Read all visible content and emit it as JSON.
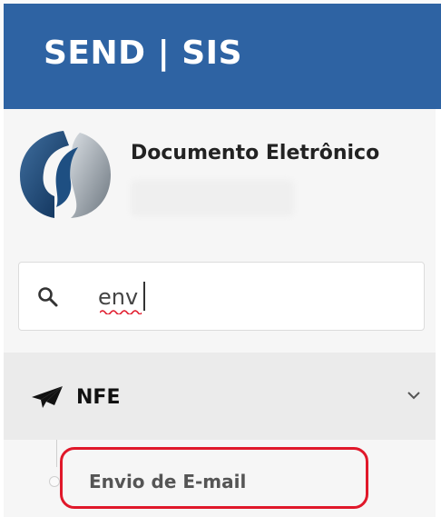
{
  "header": {
    "title": "SEND | SIS",
    "background": "#2e63a3"
  },
  "sidebar": {
    "profile": {
      "title": "Documento Eletrônico"
    },
    "search": {
      "value": "env",
      "icon": "search-icon"
    },
    "menu": [
      {
        "label": "NFE",
        "icon": "paper-plane-icon",
        "expanded": true,
        "children": [
          {
            "label": "Envio de E-mail",
            "highlighted": true
          }
        ]
      }
    ]
  },
  "colors": {
    "highlight": "#e0182a",
    "accent": "#2e63a3"
  }
}
